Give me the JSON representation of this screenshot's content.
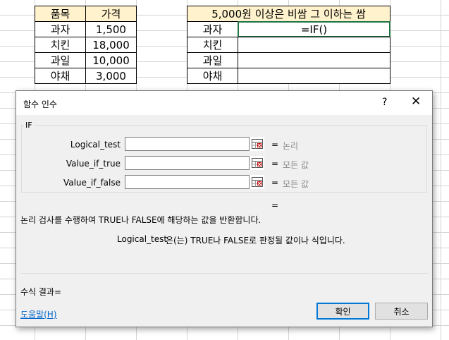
{
  "sheet": {
    "table1": {
      "headers": [
        "품목",
        "가격"
      ],
      "rows": [
        [
          "과자",
          "1,500"
        ],
        [
          "치킨",
          "18,000"
        ],
        [
          "과일",
          "10,000"
        ],
        [
          "야채",
          "3,000"
        ]
      ]
    },
    "table2": {
      "header": "5,000원 이상은 비쌈 그 이하는 쌈",
      "items": [
        "과자",
        "치킨",
        "과일",
        "야채"
      ],
      "active_formula": "=IF()"
    },
    "colors": {
      "header_fill": "#fff2cc",
      "selection_border": "#217346"
    }
  },
  "dialog": {
    "title": "함수 인수",
    "help_button": "?",
    "close_button": "✕",
    "function_name": "IF",
    "args": [
      {
        "label": "Logical_test",
        "value": "",
        "result": "논리"
      },
      {
        "label": "Value_if_true",
        "value": "",
        "result": "모든 값"
      },
      {
        "label": "Value_if_false",
        "value": "",
        "result": "모든 값"
      }
    ],
    "eq_sign": "=",
    "overall_eq": "=",
    "description": "논리 검사를 수행하여 TRUE나 FALSE에 해당하는 값을 반환합니다.",
    "arg_description_name": "Logical_test",
    "arg_description_text": "은(는) TRUE나 FALSE로 판정될 값이나 식입니다.",
    "formula_result_label": "수식 결과=",
    "help_link": "도움말(H)",
    "ok_label": "확인",
    "cancel_label": "취소"
  }
}
